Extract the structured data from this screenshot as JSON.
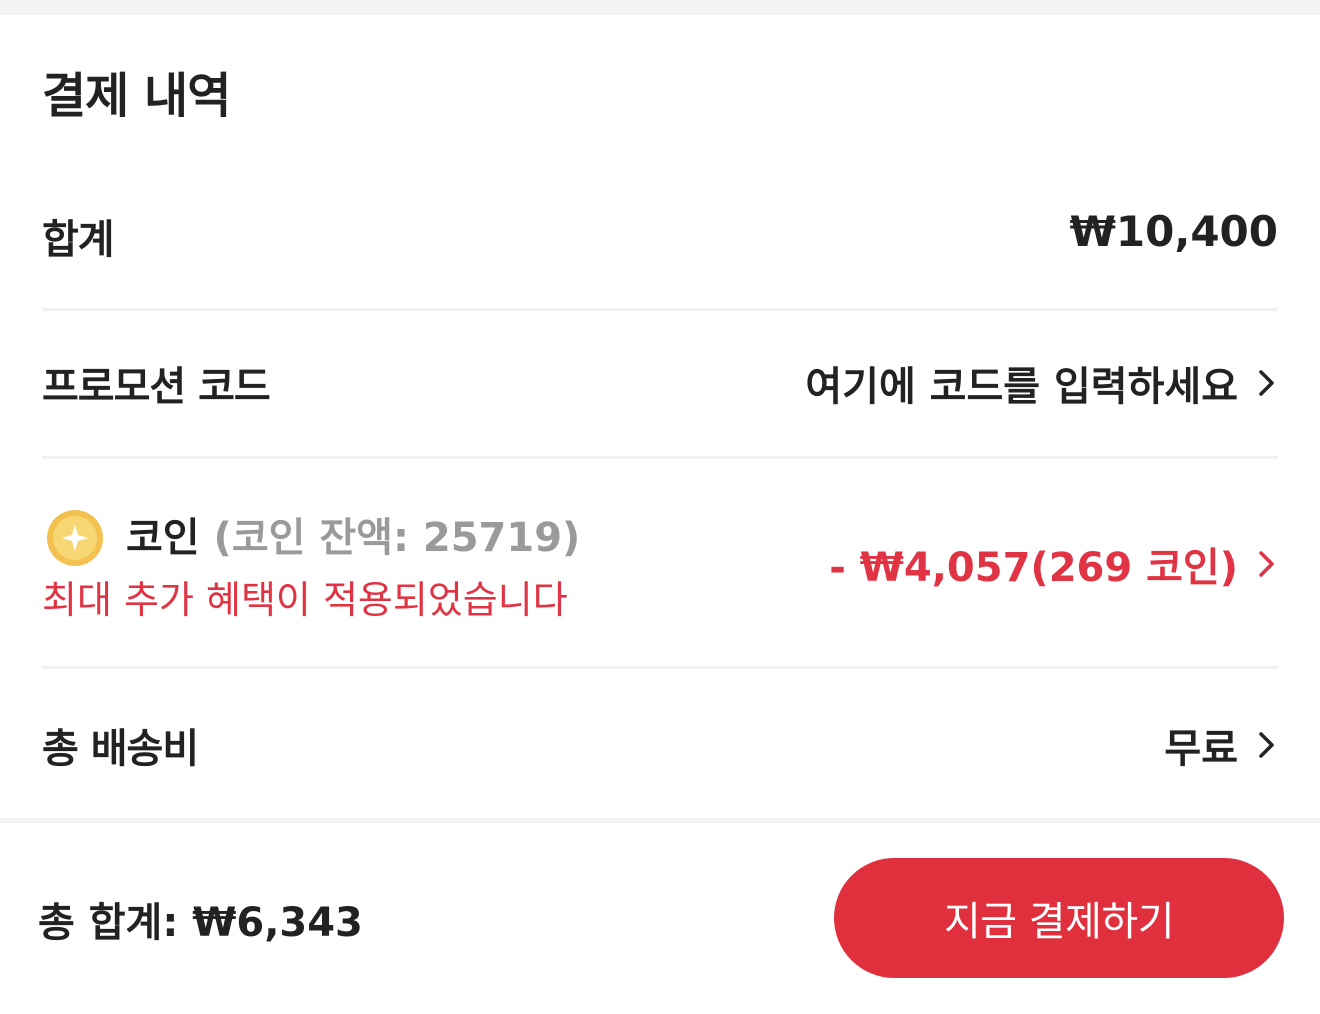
{
  "header": {
    "title": "결제 내역"
  },
  "rows": {
    "subtotal": {
      "label": "합계",
      "value": "₩10,400"
    },
    "promo": {
      "label": "프로모션 코드",
      "value": "여기에 코드를 입력하세요"
    },
    "coin": {
      "label": "코인",
      "balance": "(코인 잔액: 25719)",
      "note": "최대 추가 혜택이 적용되었습니다",
      "value": "- ₩4,057(269 코인)"
    },
    "shipping": {
      "label": "총 배송비",
      "value": "무료"
    }
  },
  "footer": {
    "total": "총 합계: ₩6,343",
    "pay_button": "지금 결제하기"
  },
  "colors": {
    "accent": "#e02f3d",
    "highlight_text": "#e03343",
    "muted_text": "#9a9a9a",
    "coin_gold": "#f2c14e"
  },
  "icons": {
    "coin": "coin-icon",
    "chevron": "chevron-right-icon"
  }
}
